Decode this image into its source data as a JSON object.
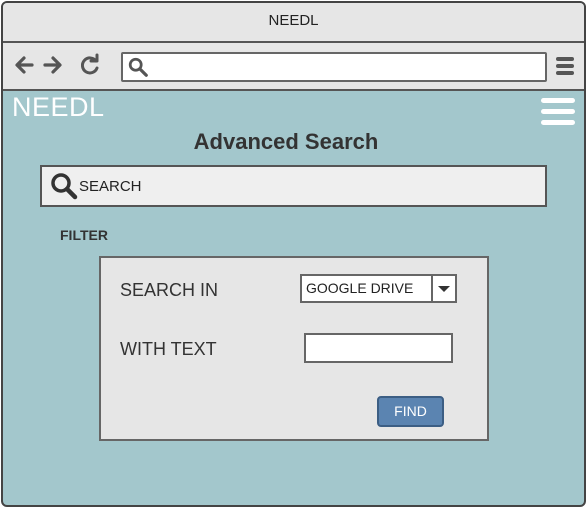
{
  "window": {
    "title": "NEEDL"
  },
  "browser": {
    "url_value": ""
  },
  "app": {
    "brand": "NEEDL",
    "page_title": "Advanced Search",
    "search": {
      "placeholder": "SEARCH"
    },
    "filter": {
      "label": "FILTER",
      "search_in_label": "SEARCH IN",
      "search_in_value": "GOOGLE DRIVE",
      "with_text_label": "WITH TEXT",
      "with_text_value": "",
      "find_label": "FIND"
    }
  },
  "colors": {
    "background": "#a3c7cc",
    "chrome": "#e6e6e6",
    "button": "#5b84b1"
  },
  "icons": [
    "back-arrow-icon",
    "forward-arrow-icon",
    "reload-icon",
    "search-icon",
    "hamburger-menu-icon",
    "dropdown-arrow-icon"
  ]
}
